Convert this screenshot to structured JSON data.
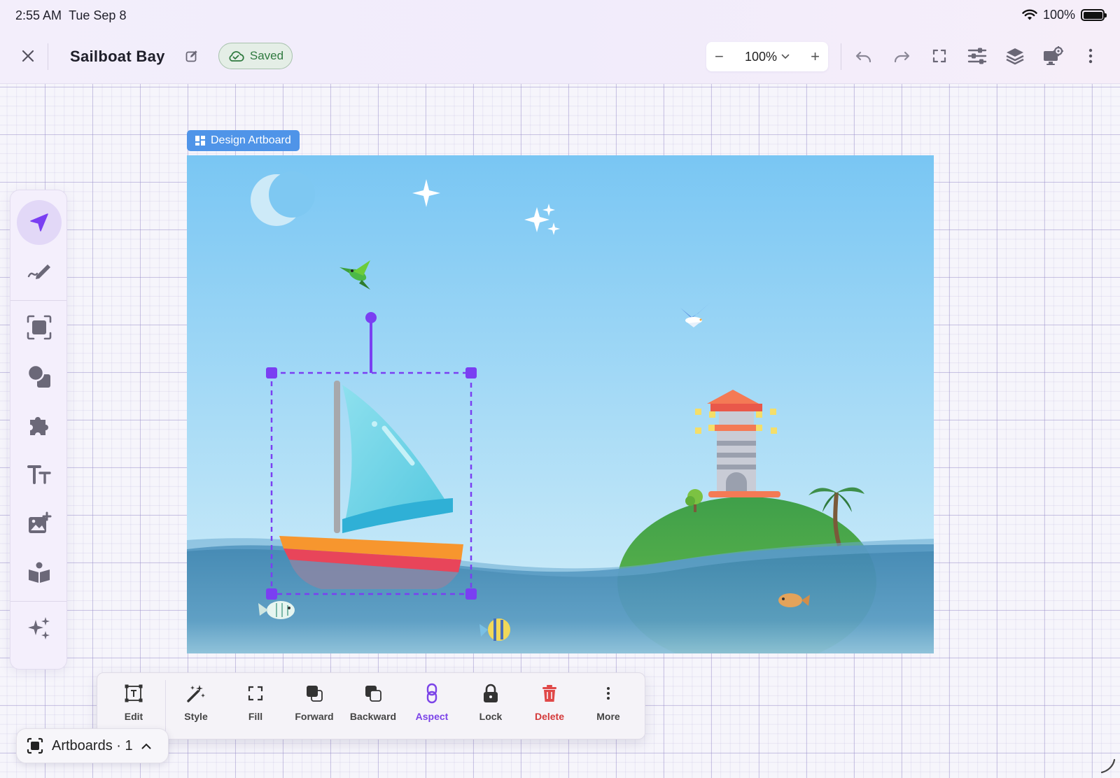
{
  "status_bar": {
    "time": "2:55 AM",
    "date": "Tue Sep 8",
    "battery": "100%",
    "battery_level": 1.0
  },
  "header": {
    "title": "Sailboat Bay",
    "saved_label": "Saved",
    "zoom": "100%"
  },
  "icons": {
    "close": "close-icon",
    "rename": "edit-icon",
    "cloud": "cloud-check-icon",
    "undo": "undo-icon",
    "redo": "redo-icon",
    "fullscreen": "fullscreen-icon",
    "adjust": "sliders-icon",
    "layers": "layers-icon",
    "display_settings": "monitor-gear-icon",
    "more": "more-vertical-icon"
  },
  "left_tools": [
    "select",
    "draw",
    "frame",
    "shapes",
    "plugins",
    "text",
    "add-image",
    "library",
    "ai-magic"
  ],
  "artboard": {
    "label": "Design Artboard"
  },
  "context_toolbar": {
    "items": [
      {
        "label": "Edit"
      },
      {
        "label": "Style"
      },
      {
        "label": "Fill"
      },
      {
        "label": "Forward"
      },
      {
        "label": "Backward"
      },
      {
        "label": "Aspect"
      },
      {
        "label": "Lock"
      },
      {
        "label": "Delete"
      },
      {
        "label": "More"
      }
    ]
  },
  "artboards_pill": {
    "label": "Artboards · 1"
  },
  "colors": {
    "accent": "#7a3ff2",
    "artboard_label": "#4f94e8",
    "saved_green": "#2f7a3f",
    "delete_red": "#d43a3a"
  }
}
